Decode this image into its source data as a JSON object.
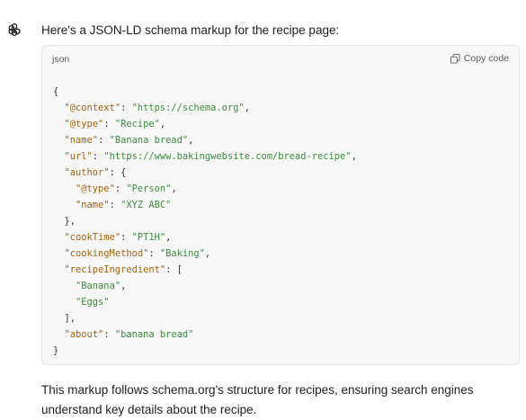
{
  "message": {
    "intro": "Here's a JSON-LD schema markup for the recipe page:",
    "outro": "This markup follows schema.org's structure for recipes, ensuring search engines understand key details about the recipe."
  },
  "code_block": {
    "language": "json",
    "copy_label": "Copy code",
    "lines": [
      [
        {
          "t": "p",
          "v": "{"
        }
      ],
      [
        {
          "t": "p",
          "v": "  "
        },
        {
          "t": "k",
          "v": "\"@context\""
        },
        {
          "t": "p",
          "v": ": "
        },
        {
          "t": "s",
          "v": "\"https://schema.org\""
        },
        {
          "t": "p",
          "v": ","
        }
      ],
      [
        {
          "t": "p",
          "v": "  "
        },
        {
          "t": "k",
          "v": "\"@type\""
        },
        {
          "t": "p",
          "v": ": "
        },
        {
          "t": "s",
          "v": "\"Recipe\""
        },
        {
          "t": "p",
          "v": ","
        }
      ],
      [
        {
          "t": "p",
          "v": "  "
        },
        {
          "t": "k",
          "v": "\"name\""
        },
        {
          "t": "p",
          "v": ": "
        },
        {
          "t": "s",
          "v": "\"Banana bread\""
        },
        {
          "t": "p",
          "v": ","
        }
      ],
      [
        {
          "t": "p",
          "v": "  "
        },
        {
          "t": "k",
          "v": "\"url\""
        },
        {
          "t": "p",
          "v": ": "
        },
        {
          "t": "s",
          "v": "\"https://www.bakingwebsite.com/bread-recipe\""
        },
        {
          "t": "p",
          "v": ","
        }
      ],
      [
        {
          "t": "p",
          "v": "  "
        },
        {
          "t": "k",
          "v": "\"author\""
        },
        {
          "t": "p",
          "v": ": {"
        }
      ],
      [
        {
          "t": "p",
          "v": "    "
        },
        {
          "t": "k",
          "v": "\"@type\""
        },
        {
          "t": "p",
          "v": ": "
        },
        {
          "t": "s",
          "v": "\"Person\""
        },
        {
          "t": "p",
          "v": ","
        }
      ],
      [
        {
          "t": "p",
          "v": "    "
        },
        {
          "t": "k",
          "v": "\"name\""
        },
        {
          "t": "p",
          "v": ": "
        },
        {
          "t": "s",
          "v": "\"XYZ ABC\""
        }
      ],
      [
        {
          "t": "p",
          "v": "  },"
        }
      ],
      [
        {
          "t": "p",
          "v": "  "
        },
        {
          "t": "k",
          "v": "\"cookTime\""
        },
        {
          "t": "p",
          "v": ": "
        },
        {
          "t": "s",
          "v": "\"PT1H\""
        },
        {
          "t": "p",
          "v": ","
        }
      ],
      [
        {
          "t": "p",
          "v": "  "
        },
        {
          "t": "k",
          "v": "\"cookingMethod\""
        },
        {
          "t": "p",
          "v": ": "
        },
        {
          "t": "s",
          "v": "\"Baking\""
        },
        {
          "t": "p",
          "v": ","
        }
      ],
      [
        {
          "t": "p",
          "v": "  "
        },
        {
          "t": "k",
          "v": "\"recipeIngredient\""
        },
        {
          "t": "p",
          "v": ": ["
        }
      ],
      [
        {
          "t": "p",
          "v": "    "
        },
        {
          "t": "s",
          "v": "\"Banana\""
        },
        {
          "t": "p",
          "v": ","
        }
      ],
      [
        {
          "t": "p",
          "v": "    "
        },
        {
          "t": "s",
          "v": "\"Eggs\""
        }
      ],
      [
        {
          "t": "p",
          "v": "  ],"
        }
      ],
      [
        {
          "t": "p",
          "v": "  "
        },
        {
          "t": "k",
          "v": "\"about\""
        },
        {
          "t": "p",
          "v": ": "
        },
        {
          "t": "s",
          "v": "\"banana bread\""
        }
      ],
      [
        {
          "t": "p",
          "v": "}"
        }
      ]
    ]
  },
  "icons": {
    "avatar": "openai-logo-icon",
    "copy": "copy-icon"
  },
  "colors": {
    "key": "#a5630f",
    "string": "#3d8b3d",
    "code_background": "#f7f7f8"
  }
}
